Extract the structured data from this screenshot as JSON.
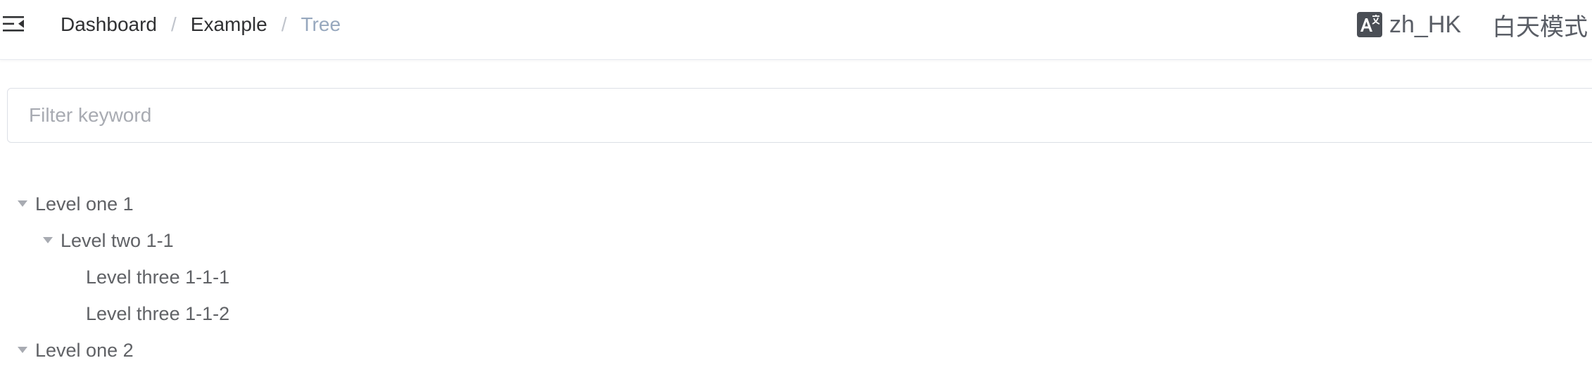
{
  "navbar": {
    "breadcrumb": [
      "Dashboard",
      "Example",
      "Tree"
    ],
    "separator": "/",
    "language": "zh_HK",
    "theme": "白天模式"
  },
  "filter": {
    "placeholder": "Filter keyword",
    "value": ""
  },
  "tree": [
    {
      "label": "Level one 1",
      "level": 1,
      "expanded": true
    },
    {
      "label": "Level two 1-1",
      "level": 2,
      "expanded": true
    },
    {
      "label": "Level three 1-1-1",
      "level": 3,
      "leaf": true
    },
    {
      "label": "Level three 1-1-2",
      "level": 3,
      "leaf": true
    },
    {
      "label": "Level one 2",
      "level": 1,
      "expanded": true
    }
  ],
  "colors": {
    "breadcrumb_current": "#97a8be",
    "text": "#606266",
    "border": "#dcdfe6"
  }
}
